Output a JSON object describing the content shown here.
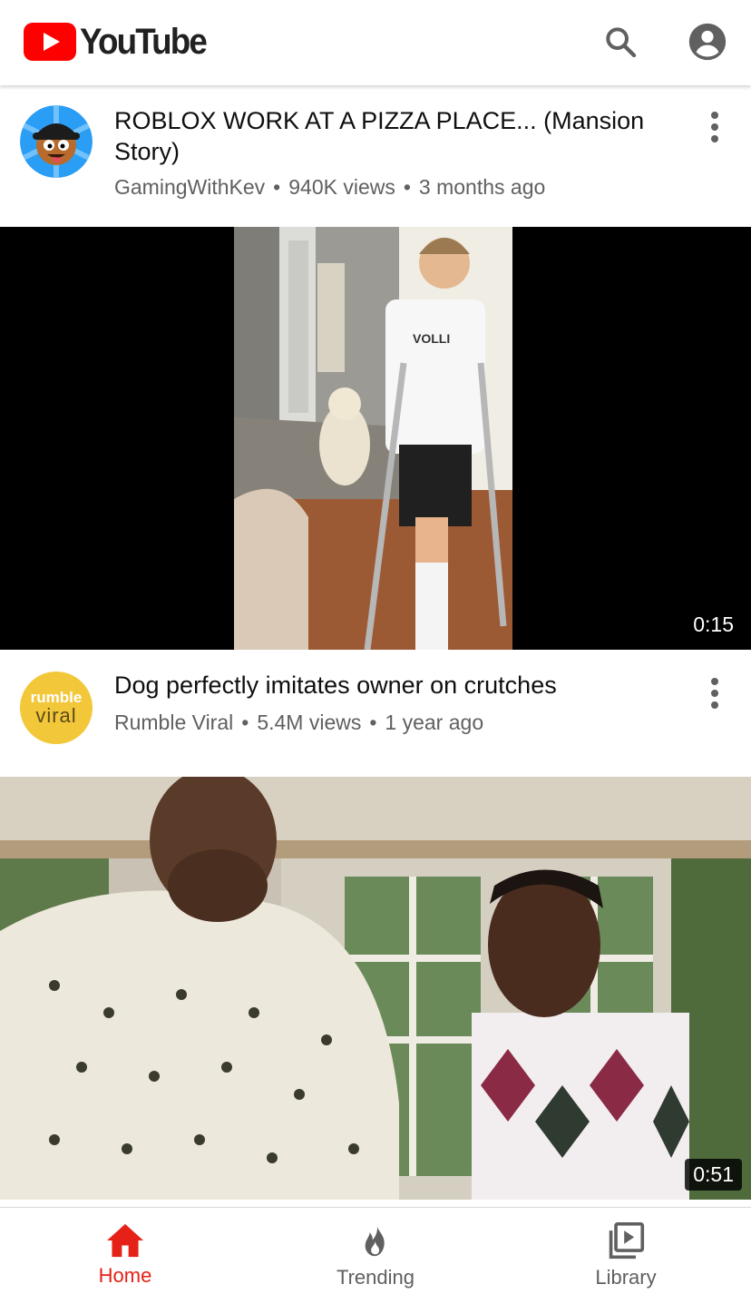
{
  "header": {
    "logo_text": "YouTube",
    "brand_color": "#ff0000",
    "icons": [
      "search-icon",
      "account-icon"
    ]
  },
  "feed": [
    {
      "title": "ROBLOX WORK AT A PIZZA PLACE... (Mansion Story)",
      "channel": "GamingWithKev",
      "views": "940K views",
      "age": "3 months ago"
    },
    {
      "duration": "0:15",
      "title": "Dog perfectly imitates owner on crutches",
      "channel": "Rumble Viral",
      "views": "5.4M views",
      "age": "1 year ago",
      "avatar_text_1": "rumble",
      "avatar_text_2": "viral"
    },
    {
      "duration": "0:51"
    }
  ],
  "bottom_nav": [
    {
      "label": "Home",
      "icon": "home-icon",
      "active": true
    },
    {
      "label": "Trending",
      "icon": "flame-icon",
      "active": false
    },
    {
      "label": "Library",
      "icon": "library-icon",
      "active": false
    }
  ],
  "colors": {
    "active": "#e62117",
    "secondary_text": "#606060"
  }
}
